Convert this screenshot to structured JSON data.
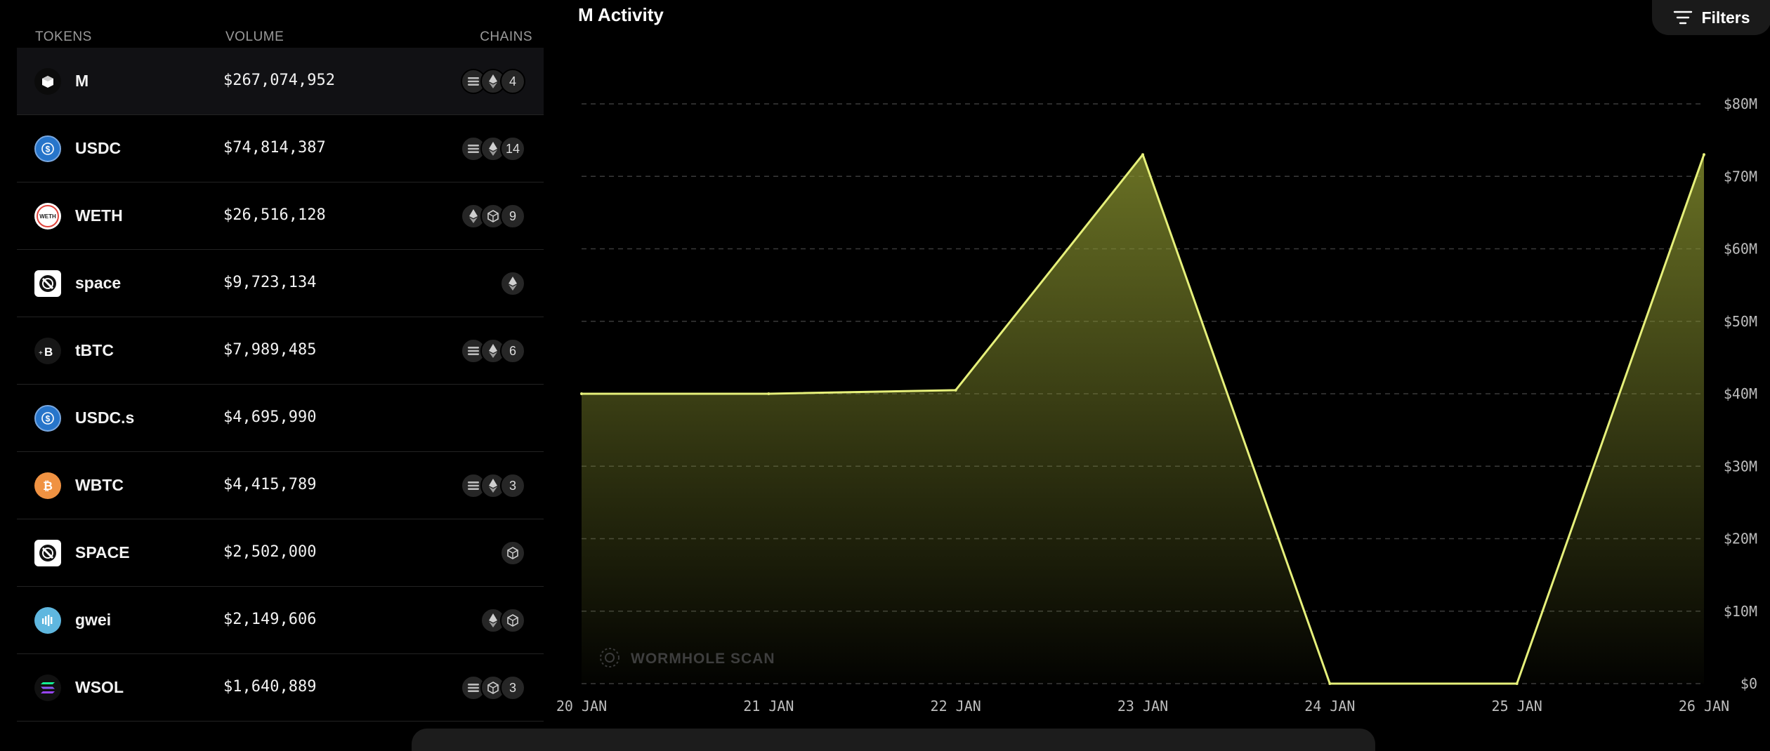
{
  "table": {
    "headers": {
      "tokens": "TOKENS",
      "volume": "VOLUME",
      "chains": "CHAINS"
    },
    "rows": [
      {
        "name": "M",
        "volume": "$267,074,952",
        "icon": "m-logo-icon",
        "chains": [
          "list-chain-icon",
          "ethereum-icon"
        ],
        "count": "4"
      },
      {
        "name": "USDC",
        "volume": "$74,814,387",
        "icon": "usdc-logo-icon",
        "chains": [
          "list-chain-icon",
          "ethereum-icon"
        ],
        "count": "14"
      },
      {
        "name": "WETH",
        "volume": "$26,516,128",
        "icon": "weth-logo-icon",
        "chains": [
          "ethereum-icon",
          "cube-chain-icon"
        ],
        "count": "9"
      },
      {
        "name": "space",
        "volume": "$9,723,134",
        "icon": "space-logo-icon",
        "chains": [
          "ethereum-icon"
        ],
        "count": ""
      },
      {
        "name": "tBTC",
        "volume": "$7,989,485",
        "icon": "tbtc-logo-icon",
        "chains": [
          "list-chain-icon",
          "ethereum-icon"
        ],
        "count": "6"
      },
      {
        "name": "USDC.s",
        "volume": "$4,695,990",
        "icon": "usdc-logo-icon",
        "chains": [],
        "count": ""
      },
      {
        "name": "WBTC",
        "volume": "$4,415,789",
        "icon": "wbtc-logo-icon",
        "chains": [
          "list-chain-icon",
          "ethereum-icon"
        ],
        "count": "3"
      },
      {
        "name": "SPACE",
        "volume": "$2,502,000",
        "icon": "space-logo-icon",
        "chains": [
          "cube-chain-icon"
        ],
        "count": ""
      },
      {
        "name": "gwei",
        "volume": "$2,149,606",
        "icon": "gwei-logo-icon",
        "chains": [
          "ethereum-icon",
          "cube-chain-icon"
        ],
        "count": ""
      },
      {
        "name": "WSOL",
        "volume": "$1,640,889",
        "icon": "wsol-logo-icon",
        "chains": [
          "list-chain-icon",
          "cube-chain-icon"
        ],
        "count": "3"
      }
    ]
  },
  "chart": {
    "title": "M Activity",
    "filters_label": "Filters",
    "watermark": "WORMHOLE SCAN"
  },
  "colors": {
    "line": "#e6f07a",
    "fill": "#8c9630",
    "grid": "#3a3a3a",
    "background": "#000000"
  },
  "chart_data": {
    "type": "area",
    "x": [
      "20 JAN",
      "21 JAN",
      "22 JAN",
      "23 JAN",
      "24 JAN",
      "25 JAN",
      "26 JAN"
    ],
    "series": [
      {
        "values": [
          40000000,
          40000000,
          40500000,
          73000000,
          0,
          0,
          73000000
        ]
      }
    ],
    "yticks": [
      "$0",
      "$10M",
      "$20M",
      "$30M",
      "$40M",
      "$50M",
      "$60M",
      "$70M",
      "$80M"
    ],
    "ylim": [
      0,
      80000000
    ],
    "grid": true,
    "y_axis_side": "right",
    "xlabel": "",
    "ylabel": ""
  }
}
